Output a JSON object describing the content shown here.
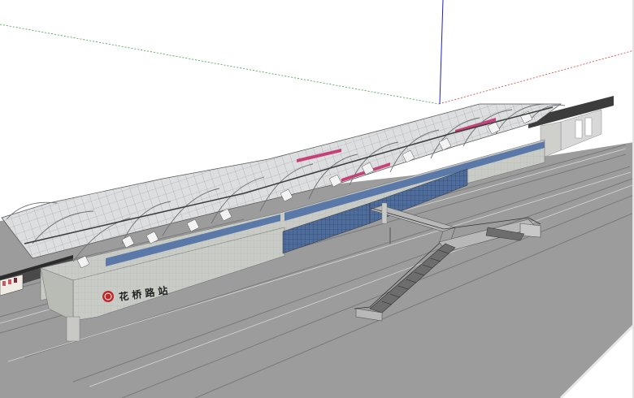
{
  "viewport": {
    "background": "#ffffff",
    "ground_color": "#9a9a9a",
    "axis_colors": {
      "red": "#d04040",
      "green": "#3fa03f",
      "blue": "#2020c8"
    }
  },
  "station": {
    "sign_text": "花 桥 路 站",
    "logo_icon": "metro-logo-icon",
    "logo_color": "#c0282a",
    "facade_color": "#c9cbc6",
    "glass_color": "#5a78a8",
    "roof_color": "#d8dadc",
    "accent_stripe": "#c8407a"
  }
}
